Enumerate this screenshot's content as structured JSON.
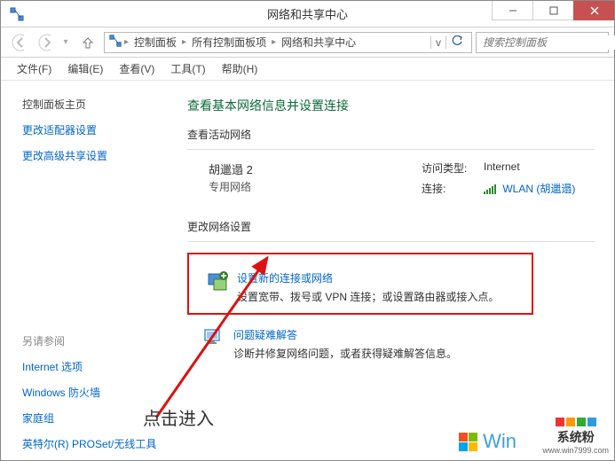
{
  "window": {
    "title": "网络和共享中心"
  },
  "breadcrumb": {
    "items": [
      "控制面板",
      "所有控制面板项",
      "网络和共享中心"
    ]
  },
  "search": {
    "placeholder": "搜索控制面板"
  },
  "menus": {
    "items": [
      "文件(F)",
      "编辑(E)",
      "查看(V)",
      "工具(T)",
      "帮助(H)"
    ]
  },
  "sidebar": {
    "home": "控制面板主页",
    "adapter": "更改适配器设置",
    "advanced": "更改高级共享设置",
    "see_also_label": "另请参阅",
    "see_also": [
      "Internet 选项",
      "Windows 防火墙",
      "家庭组",
      "英特尔(R) PROSet/无线工具"
    ]
  },
  "content": {
    "heading": "查看基本网络信息并设置连接",
    "active_label": "查看活动网络",
    "network": {
      "name": "胡邋遢  2",
      "type": "专用网络"
    },
    "kv": {
      "access_label": "访问类型:",
      "access_value": "Internet",
      "conn_label": "连接:",
      "conn_value": "WLAN (胡邋遢)"
    },
    "change_label": "更改网络设置",
    "setup": {
      "title": "设置新的连接或网络",
      "desc": "设置宽带、拨号或 VPN 连接；或设置路由器或接入点。"
    },
    "trouble": {
      "title": "问题疑难解答",
      "desc": "诊断并修复网络问题，或者获得疑难解答信息。"
    }
  },
  "annotation": {
    "text": "点击进入"
  },
  "watermarks": {
    "w1": "Win",
    "w2_line1": "系统粉",
    "w2_line2": "www.win7999.com"
  }
}
